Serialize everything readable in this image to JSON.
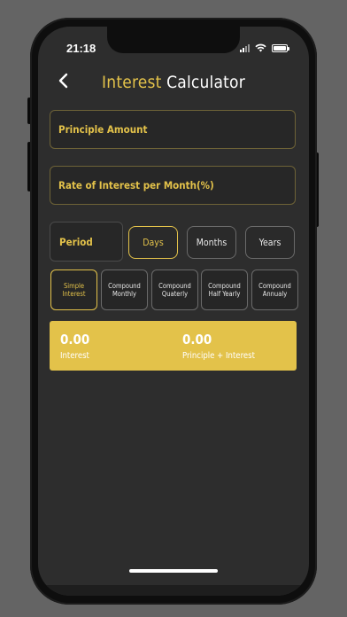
{
  "status": {
    "time": "21:18",
    "icons": [
      "signal-icon",
      "wifi-icon",
      "battery-icon"
    ]
  },
  "header": {
    "back_icon": "chevron-left-icon",
    "title_part1": "Interest",
    "title_part2": "Calculator"
  },
  "form": {
    "principle_placeholder": "Principle Amount",
    "principle_value": "",
    "rate_placeholder": "Rate of Interest per Month(%)",
    "rate_value": ""
  },
  "period": {
    "label": "Period",
    "options": [
      "Days",
      "Months",
      "Years"
    ],
    "selected": "Days"
  },
  "interest_types": {
    "options": [
      "Simple Interest",
      "Compound Monthly",
      "Compound Quaterly",
      "Compound Half Yearly",
      "Compound Annualy"
    ],
    "selected": "Simple Interest"
  },
  "results": {
    "interest_value": "0.00",
    "interest_label": "Interest",
    "total_value": "0.00",
    "total_label": "Principle + Interest"
  },
  "colors": {
    "accent": "#e3c24a",
    "background": "#2d2d2d",
    "outer": "#646464"
  }
}
